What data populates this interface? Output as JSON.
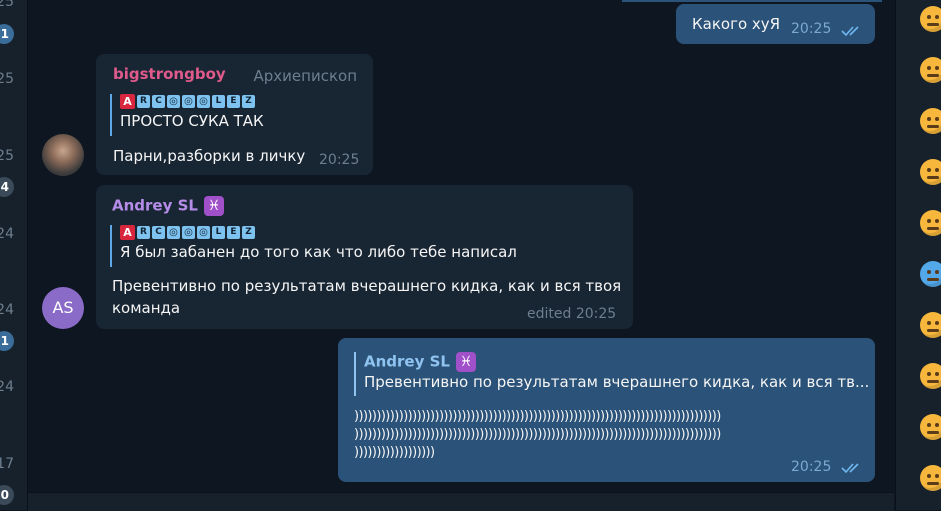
{
  "chat_list": {
    "items": [
      {
        "time": "25",
        "badge": ""
      },
      {
        "time": "",
        "badge": "1"
      },
      {
        "time": "25",
        "badge": ""
      },
      {
        "time": "25",
        "badge": ""
      },
      {
        "time": "",
        "badge": "4"
      },
      {
        "time": "24",
        "badge": ""
      },
      {
        "time": "24",
        "badge": ""
      },
      {
        "time": "",
        "badge": "1"
      },
      {
        "time": "24",
        "badge": ""
      },
      {
        "time": "17",
        "badge": ""
      },
      {
        "time": "",
        "badge": "0"
      }
    ]
  },
  "messages": {
    "m1": {
      "text": "Какого хуЯ",
      "time": "20:25"
    },
    "m2": {
      "sender": "bigstrongboy",
      "title": "Архиепископ",
      "quote_name_letters": [
        "A",
        "R",
        "C",
        "◎",
        "◎",
        "◎",
        "L",
        "E",
        "Z"
      ],
      "quote_text": "ПРОСТО СУКА ТАК",
      "text": "Парни,разборки в личку",
      "time": "20:25"
    },
    "m3": {
      "sender": "Andrey SL",
      "sender_emoji": "♓",
      "quote_name_letters": [
        "A",
        "R",
        "C",
        "◎",
        "◎",
        "◎",
        "L",
        "E",
        "Z"
      ],
      "quote_text": "Я был забанен до того как что либо тебе написал",
      "text_line1": "Превентивно по результатам вчерашнего кидка, как и вся твоя",
      "text_line2": "команда",
      "time": "edited 20:25",
      "avatar_initials": "AS"
    },
    "m4": {
      "quote_name": "Andrey SL",
      "quote_emoji": "♓",
      "quote_text": "Превентивно по результатам вчерашнего кидка, как и вся тв...",
      "line1": "))))))))))))))))))))))))))))))))))))))))))))))))))))))))))))))))))))))))))))))))))",
      "line2": "))))))))))))))))))))))))))))))))))))))))))))))))))))))))))))))))))))))))))))))))))",
      "line3": "))))))))))))))))))",
      "time": "20:25"
    }
  },
  "colors": {
    "sender_bigstrongboy": "#e05a8c",
    "sender_andrey": "#b58ce8",
    "quote_name_andrey_out": "#8fc3f0",
    "check": "#6fb8f2"
  },
  "emoji_panel": {
    "icons": [
      "tongue-wink-emoji",
      "star-struck-emoji",
      "worried-emoji",
      "tired-emoji",
      "angry-emoji",
      "freezing-emoji",
      "hugging-emoji",
      "neutral-emoji",
      "confused-emoji",
      "dizzy-emoji"
    ]
  }
}
